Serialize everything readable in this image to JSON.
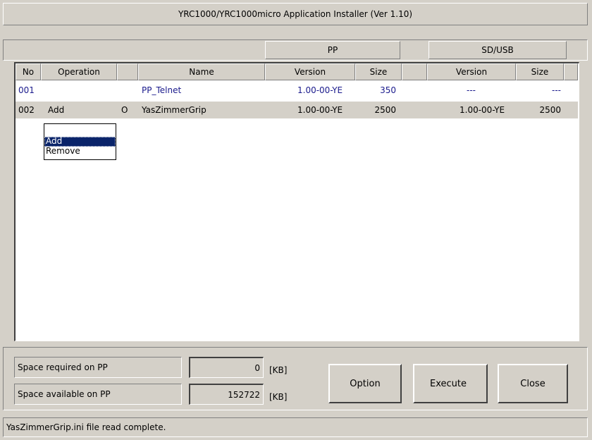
{
  "window": {
    "title": "YRC1000/YRC1000micro Application Installer  (Ver 1.10)"
  },
  "group_headers": {
    "pp": "PP",
    "sd_usb": "SD/USB"
  },
  "columns": {
    "no": "No",
    "operation": "Operation",
    "name": "Name",
    "pp_version": "Version",
    "pp_size": "Size",
    "sd_version": "Version",
    "sd_size": "Size"
  },
  "rows": [
    {
      "no": "001",
      "operation": "",
      "mark": "",
      "name": "PP_Telnet",
      "pp_version": "1.00-00-YE",
      "pp_size": "350",
      "sd_version": "---",
      "sd_size": "---"
    },
    {
      "no": "002",
      "operation": "Add",
      "mark": "O",
      "name": "YasZimmerGrip",
      "pp_version": "1.00-00-YE",
      "pp_size": "2500",
      "sd_version": "1.00-00-YE",
      "sd_size": "2500"
    }
  ],
  "operation_dropdown": {
    "current": "",
    "options": [
      "Add",
      "Remove"
    ],
    "selected": "Add"
  },
  "space": {
    "required_label": "Space required on PP",
    "required_value": "0",
    "available_label": "Space available on PP",
    "available_value": "152722",
    "unit": "[KB]"
  },
  "buttons": {
    "option": "Option",
    "execute": "Execute",
    "close": "Close"
  },
  "status": "YasZimmerGrip.ini file read complete.",
  "colors": {
    "face": "#d4d0c8",
    "selection": "#0a246a",
    "link_text": "#1a1a8c"
  }
}
